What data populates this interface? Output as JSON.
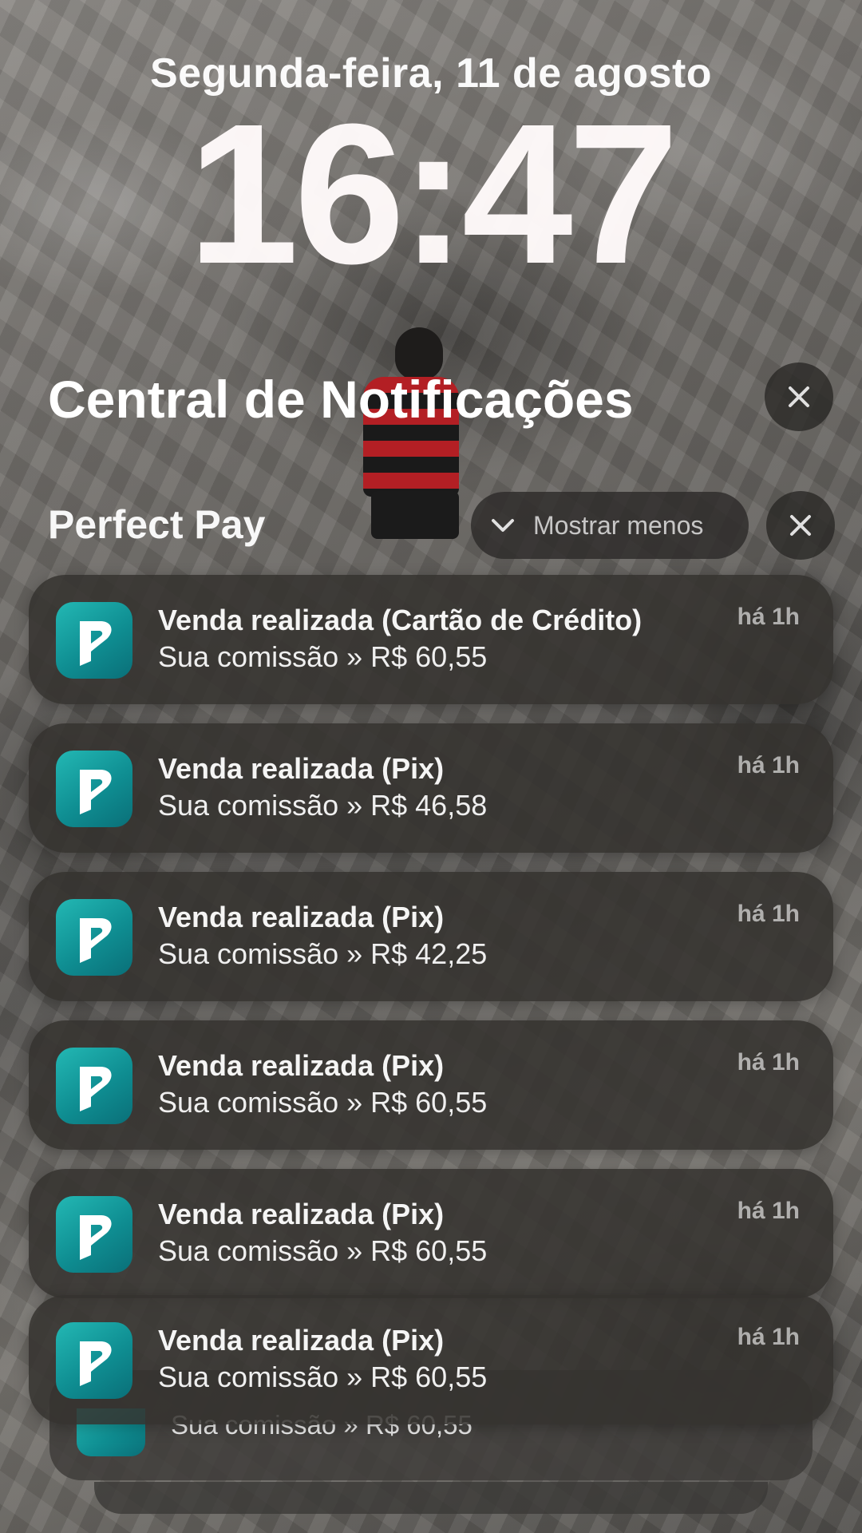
{
  "lockscreen": {
    "date": "Segunda-feira, 11 de agosto",
    "time": "16:47"
  },
  "notification_center": {
    "title": "Central de Notificações",
    "close_icon": "close-icon"
  },
  "group": {
    "app_name": "Perfect Pay",
    "show_less_label": "Mostrar menos",
    "show_less_icon": "chevron-down-icon",
    "close_icon": "close-icon",
    "app_icon": "perfect-pay-logo-icon",
    "icon_color": "#14a3a3"
  },
  "notifications": [
    {
      "title": "Venda realizada (Cartão de Crédito)",
      "body": "Sua comissão » R$ 60,55",
      "time": "há 1h"
    },
    {
      "title": "Venda realizada (Pix)",
      "body": "Sua comissão » R$ 46,58",
      "time": "há 1h"
    },
    {
      "title": "Venda realizada (Pix)",
      "body": "Sua comissão » R$ 42,25",
      "time": "há 1h"
    },
    {
      "title": "Venda realizada (Pix)",
      "body": "Sua comissão » R$ 60,55",
      "time": "há 1h"
    },
    {
      "title": "Venda realizada (Pix)",
      "body": "Sua comissão » R$ 60,55",
      "time": "há 1h"
    },
    {
      "title": "Venda realizada (Pix)",
      "body": "Sua comissão » R$ 60,55",
      "time": "há 1h"
    }
  ],
  "stacked_notification": {
    "body": "Sua comissão » R$ 60,55"
  }
}
